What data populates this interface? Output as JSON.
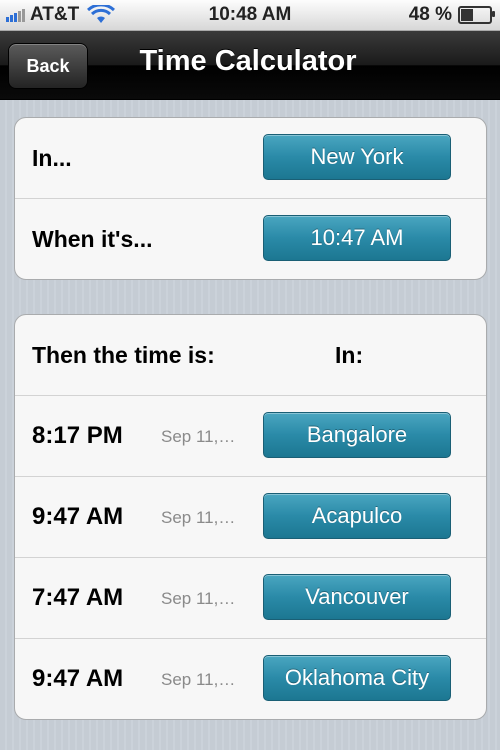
{
  "status_bar": {
    "carrier": "AT&T",
    "time": "10:48 AM",
    "battery": "48 %",
    "battery_level": 0.48
  },
  "nav": {
    "back_label": "Back",
    "title": "Time Calculator"
  },
  "input_group": {
    "in_label": "In...",
    "in_value": "New York",
    "when_label": "When it's...",
    "when_value": "10:47 AM"
  },
  "results": {
    "header_label": "Then the time is:",
    "header_in": "In:",
    "rows": [
      {
        "time": "8:17 PM",
        "date": "Sep 11,…",
        "city": "Bangalore"
      },
      {
        "time": "9:47 AM",
        "date": "Sep 11,…",
        "city": "Acapulco"
      },
      {
        "time": "7:47 AM",
        "date": "Sep 11,…",
        "city": "Vancouver"
      },
      {
        "time": "9:47 AM",
        "date": "Sep 11,…",
        "city": "Oklahoma City"
      }
    ]
  },
  "icons": {
    "signal": "signal-bars-icon",
    "wifi": "wifi-icon",
    "battery": "battery-icon"
  },
  "colors": {
    "accent": "#2a8aa8",
    "nav_bg": "#1a1a1a",
    "background": "#c5ccd4"
  }
}
